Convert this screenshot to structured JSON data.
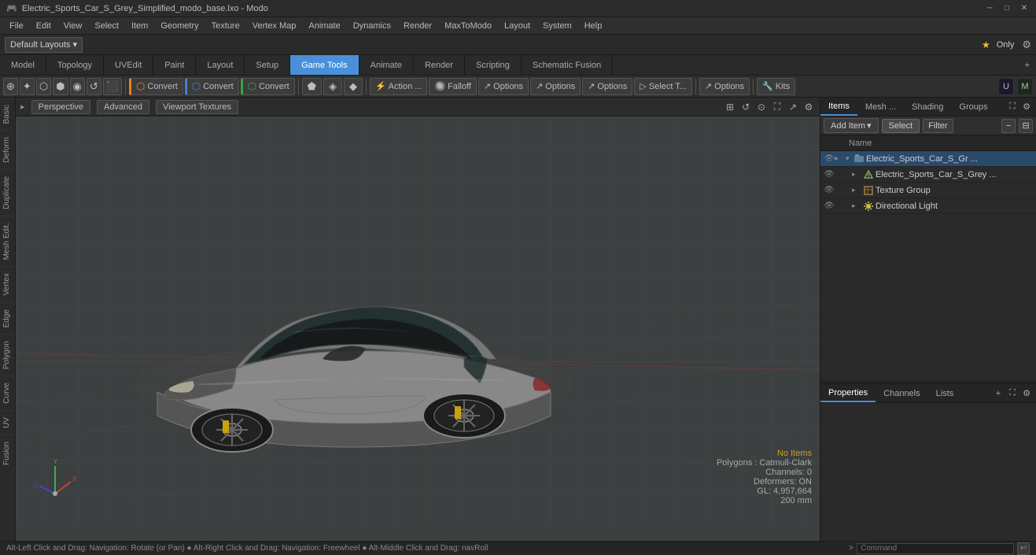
{
  "titlebar": {
    "title": "Electric_Sports_Car_S_Grey_Simplified_modo_base.lxo - Modo",
    "app": "Modo",
    "controls": [
      "minimize",
      "maximize",
      "close"
    ]
  },
  "menubar": {
    "items": [
      "File",
      "Edit",
      "View",
      "Select",
      "Item",
      "Geometry",
      "Texture",
      "Vertex Map",
      "Animate",
      "Dynamics",
      "Render",
      "MaxToModo",
      "Layout",
      "System",
      "Help"
    ]
  },
  "layoutbar": {
    "dropdown_label": "Default Layouts ▾",
    "star": "★",
    "only_label": "Only",
    "gear_icon": "⚙"
  },
  "tabbar": {
    "tabs": [
      "Model",
      "Topology",
      "UVEdit",
      "Paint",
      "Layout",
      "Setup",
      "Game Tools",
      "Animate",
      "Render",
      "Scripting",
      "Schematic Fusion"
    ],
    "active": "Model",
    "add_icon": "+"
  },
  "toolbar": {
    "buttons": [
      {
        "label": "Convert",
        "type": "orange"
      },
      {
        "label": "Convert",
        "type": "blue"
      },
      {
        "label": "Convert",
        "type": "green"
      }
    ],
    "action_label": "Action ...",
    "falloff_label": "Falloff",
    "options_label": "Options",
    "options2_label": "Options",
    "options3_label": "Options",
    "select_label": "Select T...",
    "options4_label": "Options",
    "kits_label": "Kits",
    "unreal_icon": "U",
    "modo_icon": "M"
  },
  "viewport": {
    "perspective_label": "Perspective",
    "advanced_label": "Advanced",
    "textures_label": "Viewport Textures",
    "status_text": "Alt-Left Click and Drag: Navigation: Rotate (or Pan) ● Alt-Right Click and Drag: Navigation: Freewheel ● Alt-Middle Click and Drag: navRoll",
    "info": {
      "no_items": "No Items",
      "polygons": "Polygons : Catmull-Clark",
      "channels": "Channels: 0",
      "deformers": "Deformers: ON",
      "gl": "GL: 4,957,664",
      "size": "200 mm"
    }
  },
  "left_sidebar": {
    "tabs": [
      "Basic",
      "Deform",
      "Duplicate",
      "Mesh Edit",
      "Vertex",
      "Edge",
      "Polygon",
      "Curve",
      "UV",
      "Fusion"
    ]
  },
  "right_panel": {
    "top_tabs": [
      "Items",
      "Mesh ...",
      "Shading",
      "Groups"
    ],
    "active_tab": "Items",
    "add_item_label": "Add Item",
    "select_label": "Select",
    "filter_label": "Filter",
    "name_header": "Name",
    "items": [
      {
        "id": 1,
        "level": 0,
        "name": "Electric_Sports_Car_S_Gr ...",
        "type": "group",
        "expanded": true,
        "eye": true,
        "children": [
          {
            "id": 2,
            "level": 1,
            "name": "Electric_Sports_Car_S_Grey ...",
            "type": "mesh",
            "expanded": false,
            "eye": true
          }
        ]
      },
      {
        "id": 3,
        "level": 1,
        "name": "Texture Group",
        "type": "texture",
        "expanded": false,
        "eye": true
      },
      {
        "id": 4,
        "level": 1,
        "name": "Directional Light",
        "type": "light",
        "expanded": false,
        "eye": true
      }
    ],
    "properties_tabs": [
      "Properties",
      "Channels",
      "Lists"
    ],
    "active_prop_tab": "Properties",
    "add_prop_icon": "+"
  },
  "statusbar": {
    "status_text": "Alt-Left Click and Drag: Navigation: Rotate (or Pan) ● Alt-Right Click and Drag: Navigation: Freewheel ● Alt-Middle Click and Drag: navRoll",
    "command_placeholder": "Command",
    "dot1": "green",
    "dot2": "grey"
  },
  "colors": {
    "accent_blue": "#4a90d9",
    "tab_active": "#4a90d9",
    "convert_orange": "#e88020",
    "convert_blue": "#4a80d0",
    "convert_green": "#40a040",
    "no_items_orange": "#c8a020",
    "bg_dark": "#2a2a2a",
    "bg_mid": "#2f2f2f",
    "bg_light": "#3c3c3c"
  }
}
